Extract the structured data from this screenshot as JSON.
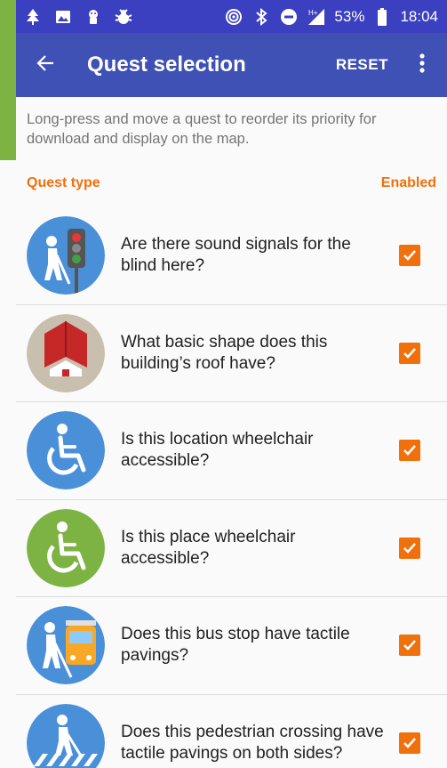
{
  "status_bar": {
    "battery": "53%",
    "time": "18:04",
    "icons_left": [
      "tree-icon",
      "image-icon",
      "android-icon",
      "bug-icon"
    ],
    "icons_right": [
      "hotspot-icon",
      "bluetooth-icon",
      "do-not-disturb-icon",
      "signal-icon",
      "battery-icon"
    ]
  },
  "toolbar": {
    "title": "Quest selection",
    "reset_label": "RESET",
    "back_icon": "arrow-left-icon",
    "more_icon": "more-vert-icon"
  },
  "hint": "Long-press and move a quest to reorder its priority for download and display on the map.",
  "header": {
    "quest_type": "Quest type",
    "enabled": "Enabled"
  },
  "quests": [
    {
      "title": "Are there sound signals for the blind here?",
      "icon": "traffic-signal-blind-icon",
      "enabled": true
    },
    {
      "title": "What basic shape does this building’s roof have?",
      "icon": "roof-shape-icon",
      "enabled": true
    },
    {
      "title": "Is this location wheelchair accessible?",
      "icon": "wheelchair-blue-icon",
      "enabled": true
    },
    {
      "title": "Is this place wheelchair accessible?",
      "icon": "wheelchair-green-icon",
      "enabled": true
    },
    {
      "title": "Does this bus stop have tactile pavings?",
      "icon": "bus-stop-blind-icon",
      "enabled": true
    },
    {
      "title": "Does this pedestrian crossing have tactile pavings on both sides?",
      "icon": "crossing-blind-icon",
      "enabled": true
    }
  ],
  "colors": {
    "status_bar": "#3b40c0",
    "toolbar": "#3f51b5",
    "accent": "#f0700c",
    "icon_blue": "#4a90d9",
    "icon_green": "#7cb343",
    "icon_beige": "#c9bfae"
  }
}
